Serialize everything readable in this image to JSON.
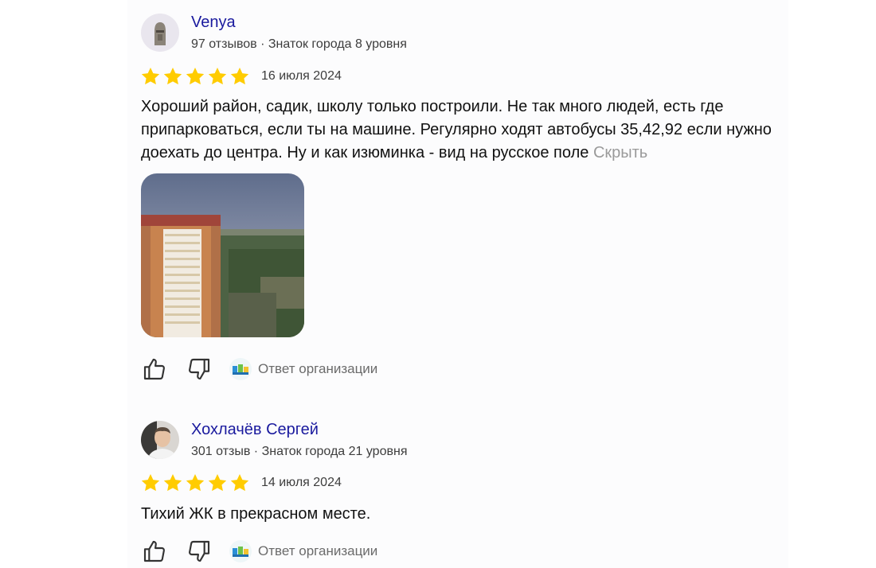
{
  "reviews": [
    {
      "author": {
        "name": "Venya",
        "meta": "97 отзывов · Знаток города 8 уровня"
      },
      "rating": 5,
      "date": "16 июля 2024",
      "text": "Хороший район, садик, школу только построили. Не так много людей, есть где припарковаться, если ты на машине. Регулярно ходят автобусы 35,42,92 если нужно доехать до центра. Ну и как изюминка - вид на русское поле",
      "hide_label": "Скрыть",
      "org_reply_label": "Ответ организации"
    },
    {
      "author": {
        "name": "Хохлачёв Сергей",
        "meta": "301 отзыв · Знаток города 21 уровня"
      },
      "rating": 5,
      "date": "14 июля 2024",
      "text": "Тихий ЖК в прекрасном месте.",
      "org_reply_label": "Ответ организации"
    }
  ],
  "colors": {
    "star": "#ffcc00",
    "author_link": "#1a1a9e",
    "muted": "#9a9a9a"
  },
  "icons": [
    "star-icon",
    "thumbs-up-icon",
    "thumbs-down-icon",
    "organization-logo-icon"
  ]
}
